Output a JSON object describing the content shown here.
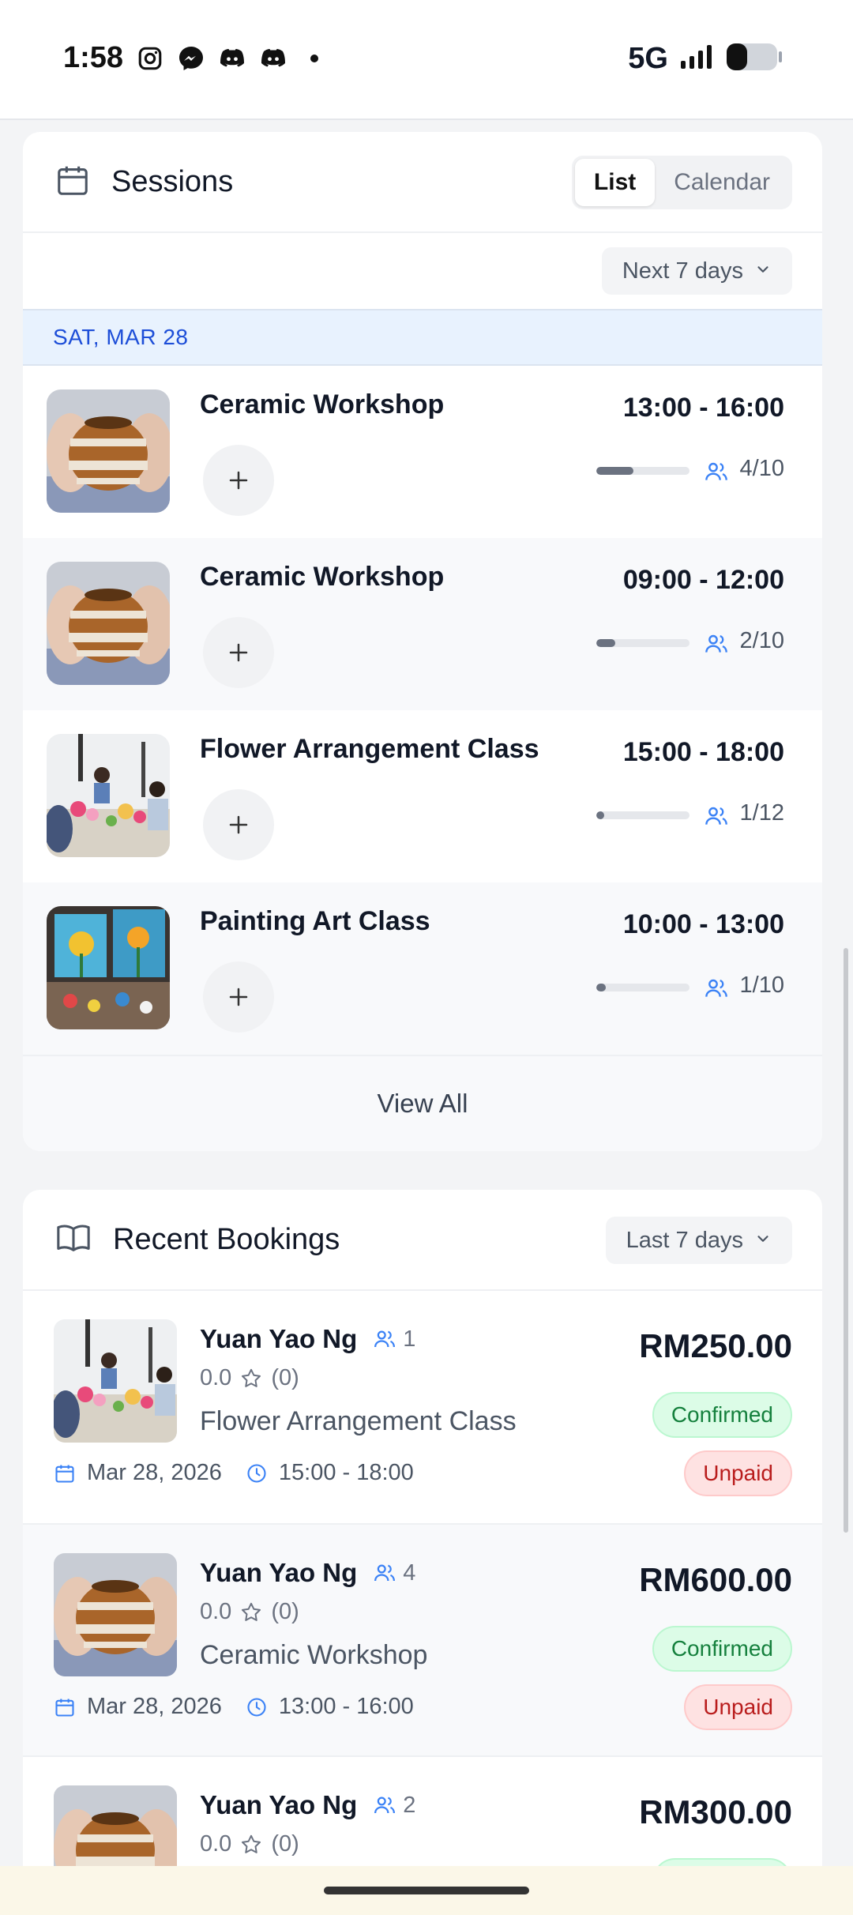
{
  "status_bar": {
    "time": "1:58",
    "network": "5G"
  },
  "sessions": {
    "title": "Sessions",
    "view_toggle": {
      "list": "List",
      "calendar": "Calendar",
      "active": "List"
    },
    "range_filter": "Next 7 days",
    "date_header": "SAT, MAR 28",
    "items": [
      {
        "name": "Ceramic Workshop",
        "time": "13:00 - 16:00",
        "capacity": "4/10",
        "fill": 0.4,
        "image": "ceramic-pot"
      },
      {
        "name": "Ceramic Workshop",
        "time": "09:00 - 12:00",
        "capacity": "2/10",
        "fill": 0.2,
        "image": "ceramic-pot"
      },
      {
        "name": "Flower Arrangement Class",
        "time": "15:00 - 18:00",
        "capacity": "1/12",
        "fill": 0.083,
        "image": "flower-class"
      },
      {
        "name": "Painting Art Class",
        "time": "10:00 - 13:00",
        "capacity": "1/10",
        "fill": 0.1,
        "image": "painting-class"
      }
    ],
    "view_all": "View All"
  },
  "bookings": {
    "title": "Recent Bookings",
    "range_filter": "Last 7 days",
    "items": [
      {
        "customer": "Yuan Yao Ng",
        "guests": "1",
        "rating": "0.0",
        "reviews": "(0)",
        "class": "Flower Arrangement Class",
        "date": "Mar 28, 2026",
        "time": "15:00 - 18:00",
        "price": "RM250.00",
        "status": "Confirmed",
        "payment": "Unpaid",
        "image": "flower-class"
      },
      {
        "customer": "Yuan Yao Ng",
        "guests": "4",
        "rating": "0.0",
        "reviews": "(0)",
        "class": "Ceramic Workshop",
        "date": "Mar 28, 2026",
        "time": "13:00 - 16:00",
        "price": "RM600.00",
        "status": "Confirmed",
        "payment": "Unpaid",
        "image": "ceramic-pot"
      },
      {
        "customer": "Yuan Yao Ng",
        "guests": "2",
        "rating": "0.0",
        "reviews": "(0)",
        "price": "RM300.00",
        "status": "Confirmed",
        "image": "ceramic-pot"
      }
    ]
  },
  "colors": {
    "accent_blue": "#1d4ed8",
    "confirmed_green": "#15803d",
    "unpaid_red": "#b91c1c"
  }
}
